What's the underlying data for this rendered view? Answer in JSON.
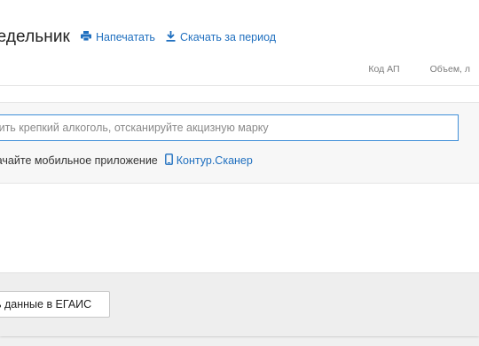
{
  "header": {
    "title": "недельник",
    "print_label": "Напечатать",
    "download_label": "Скачать за период"
  },
  "table": {
    "columns": [
      "Код АП",
      "Объем, л"
    ]
  },
  "scan": {
    "placeholder": "авить крепкий алкоголь, отсканируйте акцизную марку",
    "download_text": "качайте мобильное приложение",
    "app_link": "Контур.Сканер"
  },
  "footer": {
    "send_button": "ь данные в ЕГАИС"
  },
  "colors": {
    "accent": "#1f6fbf",
    "input_border": "#3f8fd8"
  },
  "icons": {
    "print": "printer-icon",
    "download": "download-icon",
    "phone": "phone-icon"
  }
}
